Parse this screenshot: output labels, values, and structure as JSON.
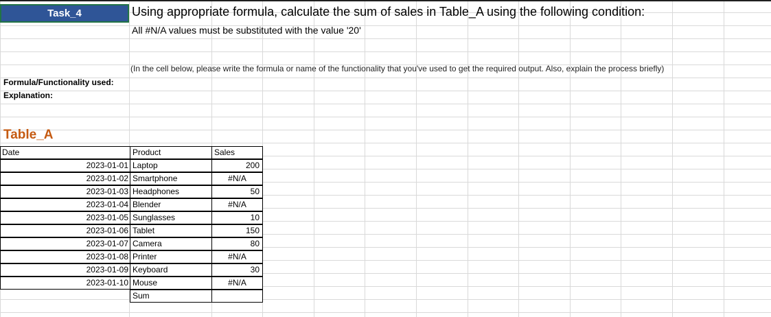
{
  "task": {
    "label": "Task_4"
  },
  "instructions": {
    "title": "Using appropriate formula, calculate the sum of sales in Table_A using the following condition:",
    "condition": "All #N/A values must be substituted with the value '20'",
    "hint": "(In the cell below, please write the formula or name of the functionality that you've used to get the required output. Also, explain the process briefly)"
  },
  "labels": {
    "formula": "Formula/Functionality used:",
    "explanation": "Explanation:"
  },
  "table": {
    "name": "Table_A",
    "headers": {
      "date": "Date",
      "product": "Product",
      "sales": "Sales"
    },
    "rows": [
      {
        "date": "2023-01-01",
        "product": "Laptop",
        "sales": "200"
      },
      {
        "date": "2023-01-02",
        "product": "Smartphone",
        "sales": "#N/A"
      },
      {
        "date": "2023-01-03",
        "product": "Headphones",
        "sales": "50"
      },
      {
        "date": "2023-01-04",
        "product": "Blender",
        "sales": "#N/A"
      },
      {
        "date": "2023-01-05",
        "product": "Sunglasses",
        "sales": "10"
      },
      {
        "date": "2023-01-06",
        "product": "Tablet",
        "sales": "150"
      },
      {
        "date": "2023-01-07",
        "product": "Camera",
        "sales": "80"
      },
      {
        "date": "2023-01-08",
        "product": "Printer",
        "sales": "#N/A"
      },
      {
        "date": "2023-01-09",
        "product": "Keyboard",
        "sales": "30"
      },
      {
        "date": "2023-01-10",
        "product": "Mouse",
        "sales": "#N/A"
      }
    ],
    "sum_label": "Sum"
  },
  "colors": {
    "task_fill": "#2f5597",
    "table_name": "#c55a11",
    "gridline": "#d9d9d9"
  }
}
